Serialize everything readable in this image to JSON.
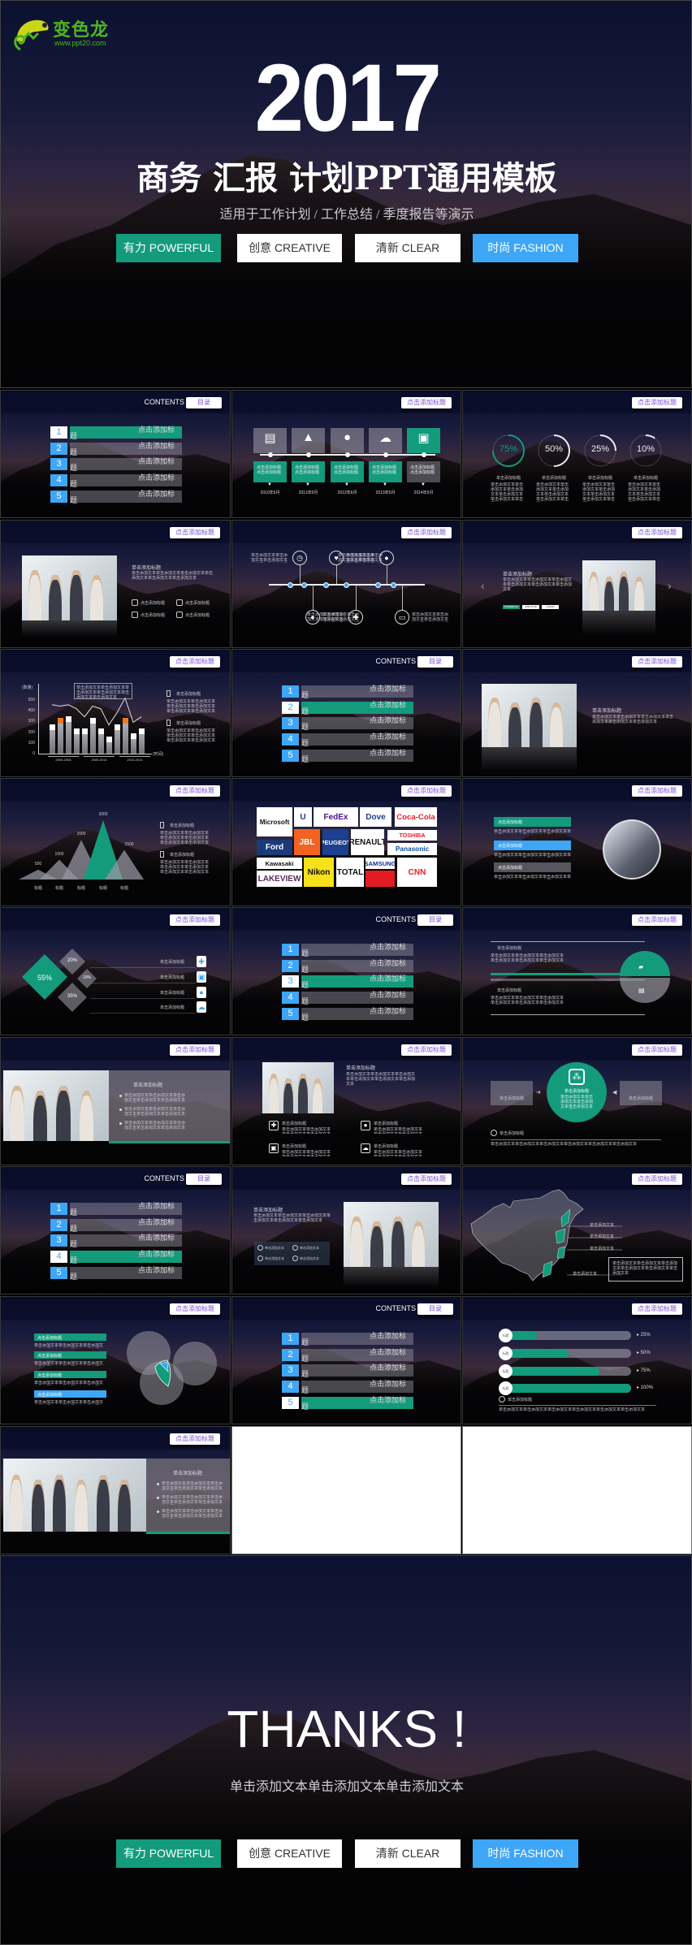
{
  "logo": {
    "name": "变色龙",
    "url": "www.ppt20.com"
  },
  "colors": {
    "green": "#139b7c",
    "blue": "#3ea6f7",
    "gray_bar": "rgba(150,150,165,0.45)",
    "tag_text": "#7a4fd6",
    "logo_green": "#4db51f"
  },
  "cover": {
    "year": "2017",
    "title": "商务 汇报 计划PPT通用模板",
    "subtitle": "适用于工作计划 / 工作总结 / 季度报告等演示",
    "buttons": [
      {
        "label": "有力 POWERFUL",
        "style": "green"
      },
      {
        "label": "创意 CREATIVE",
        "style": "white"
      },
      {
        "label": "清新 CLEAR",
        "style": "white"
      },
      {
        "label": "时尚 FASHION",
        "style": "blue"
      }
    ]
  },
  "tag_label": "点击添加标题",
  "contents": {
    "header": "CONTENTS",
    "tag": "目录",
    "item": "点击添加标题"
  },
  "click_title": "单击添加标题",
  "click_text": "单击添加文本",
  "body": "单击添加文本单击添加文本单击添加文本单击添加文本单击添加文本单击添加文本",
  "slides": [
    {
      "type": "contents",
      "active": 1
    },
    {
      "type": "years",
      "icons": [
        "document-icon",
        "warning-icon",
        "lightbulb-icon",
        "cloud-icon",
        "printer-icon"
      ],
      "years": [
        "2010年6月",
        "2011年6月",
        "2012年6月",
        "2013年6月",
        "2014年6月"
      ],
      "box_text": "点击添加标题"
    },
    {
      "type": "rings",
      "values": [
        75,
        50,
        25,
        10
      ],
      "labels": [
        "75%",
        "50%",
        "25%",
        "10%"
      ]
    },
    {
      "type": "photo_icons"
    },
    {
      "type": "icon_timeline"
    },
    {
      "type": "photo_carousel",
      "mini_buttons": [
        "POWERFUL",
        "CREATIVE",
        "CLEAR"
      ]
    },
    {
      "type": "bar_chart",
      "ylabel": "(数量)",
      "xlabel": "(时间)",
      "yticks": [
        "0",
        "100",
        "200",
        "300",
        "400",
        "500"
      ],
      "groups": [
        "2000-2005",
        "2005-2010",
        "2010-2014"
      ],
      "values": [
        275,
        337,
        350,
        237,
        237,
        337,
        237,
        162,
        275,
        337,
        187,
        237
      ],
      "highlight": [
        1,
        9
      ]
    },
    {
      "type": "contents",
      "active": 2
    },
    {
      "type": "photo_text"
    },
    {
      "type": "triangles",
      "values": [
        500,
        1000,
        2000,
        3000,
        1500
      ],
      "labels": [
        "500",
        "1000",
        "2000",
        "3000",
        "1500"
      ],
      "category": "标题",
      "highlight": 3
    },
    {
      "type": "logos",
      "logos": [
        {
          "text": "Microsoft",
          "color": "#111",
          "bg": "#fff"
        },
        {
          "text": "U",
          "color": "#1f3c88",
          "bg": "#fff"
        },
        {
          "text": "FedEx",
          "color": "#4d148c",
          "bg": "#fff"
        },
        {
          "text": "Dove",
          "color": "#1f3c88",
          "bg": "#fff"
        },
        {
          "text": "Coca-Cola",
          "color": "#e41e2b",
          "bg": "#fff"
        },
        {
          "text": "Ford",
          "color": "#fff",
          "bg": "#1a3b7a"
        },
        {
          "text": "JBL",
          "color": "#fff",
          "bg": "#f26322"
        },
        {
          "text": "PEUGEOT",
          "color": "#fff",
          "bg": "#1d3f8f"
        },
        {
          "text": "RENAULT",
          "color": "#111",
          "bg": "#fff"
        },
        {
          "text": "TOSHIBA",
          "color": "#e41e2b",
          "bg": "#fff"
        },
        {
          "text": "Panasonic",
          "color": "#1251a3",
          "bg": "#fff"
        },
        {
          "text": "Kawasaki",
          "color": "#111",
          "bg": "#fff"
        },
        {
          "text": "LAKEVIEW",
          "color": "#5a2a5a",
          "bg": "#fff"
        },
        {
          "text": "Nikon",
          "color": "#111",
          "bg": "#f7e11b"
        },
        {
          "text": "TOTAL",
          "color": "#111",
          "bg": "#fff"
        },
        {
          "text": "SAMSUNG",
          "color": "#1428a0",
          "bg": "#fff"
        },
        {
          "text": "",
          "color": "#fff",
          "bg": "#e31b23"
        },
        {
          "text": "CNN",
          "color": "#e41e2b",
          "bg": "#fff"
        }
      ]
    },
    {
      "type": "list_circle",
      "bars": [
        "green",
        "blue",
        "gray"
      ]
    },
    {
      "type": "diamonds",
      "labels": [
        "55%",
        "20%",
        "10%",
        "35%"
      ],
      "icons": [
        "plus-icon",
        "tablet-icon",
        "pin-icon",
        "cloud-icon"
      ]
    },
    {
      "type": "contents",
      "active": 3
    },
    {
      "type": "split"
    },
    {
      "type": "photo_panel",
      "photo": "meeting"
    },
    {
      "type": "photo_grid_icons",
      "icons": [
        "plus-icon",
        "pin-icon",
        "tablet-icon",
        "cloud-icon"
      ]
    },
    {
      "type": "flow"
    },
    {
      "type": "contents",
      "active": 4
    },
    {
      "type": "text_photo"
    },
    {
      "type": "map"
    },
    {
      "type": "venn",
      "bars": [
        "green",
        "green",
        "green",
        "blue"
      ]
    },
    {
      "type": "contents",
      "active": 5
    },
    {
      "type": "progress",
      "values": [
        25,
        50,
        75,
        100
      ],
      "labels": [
        "25%",
        "50%",
        "75%",
        "100%"
      ],
      "category": "标题"
    },
    {
      "type": "photo_panel",
      "photo": "boardroom"
    },
    {
      "type": "blank"
    },
    {
      "type": "blank"
    }
  ],
  "thanks": {
    "title": "THANKS !",
    "subtitle": "单击添加文本单击添加文本单击添加文本",
    "buttons": [
      {
        "label": "有力 POWERFUL",
        "style": "green"
      },
      {
        "label": "创意 CREATIVE",
        "style": "white"
      },
      {
        "label": "清新 CLEAR",
        "style": "white"
      },
      {
        "label": "时尚 FASHION",
        "style": "blue"
      }
    ]
  }
}
